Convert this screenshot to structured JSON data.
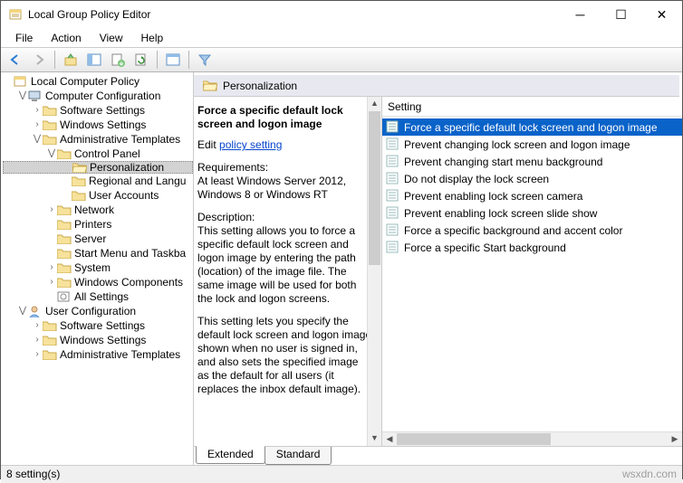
{
  "window": {
    "title": "Local Group Policy Editor"
  },
  "menu": {
    "file": "File",
    "action": "Action",
    "view": "View",
    "help": "Help"
  },
  "tree": {
    "root": "Local Computer Policy",
    "cc": "Computer Configuration",
    "ss": "Software Settings",
    "ws": "Windows Settings",
    "at": "Administrative Templates",
    "cp": "Control Panel",
    "pers": "Personalization",
    "rl": "Regional and Langu",
    "ua": "User Accounts",
    "net": "Network",
    "prn": "Printers",
    "srv": "Server",
    "smt": "Start Menu and Taskba",
    "sys": "System",
    "wc": "Windows Components",
    "allset": "All Settings",
    "uc": "User Configuration",
    "uss": "Software Settings",
    "uws": "Windows Settings",
    "uat": "Administrative Templates"
  },
  "crumb": {
    "title": "Personalization"
  },
  "desc": {
    "title": "Force a specific default lock screen and logon image",
    "edit_prefix": "Edit ",
    "edit_link": "policy setting ",
    "req_h": "Requirements:",
    "req_b": "At least Windows Server 2012, Windows 8 or Windows RT",
    "desc_h": "Description:",
    "desc_b1": "This setting allows you to force a specific default lock screen and logon image by entering the path (location) of the image file. The same image will be used for both the lock and logon screens.",
    "desc_b2": "This setting lets you specify the default lock screen and logon image shown when no user is signed in, and also sets the specified image as the default for all users (it replaces the inbox default image)."
  },
  "list": {
    "header": "Setting",
    "items": [
      "Force a specific default lock screen and logon image",
      "Prevent changing lock screen and logon image",
      "Prevent changing start menu background",
      "Do not display the lock screen",
      "Prevent enabling lock screen camera",
      "Prevent enabling lock screen slide show",
      "Force a specific background and accent color",
      "Force a specific Start background"
    ]
  },
  "tabs": {
    "ext": "Extended",
    "std": "Standard"
  },
  "status": {
    "left": "8 setting(s)",
    "right": "wsxdn.com"
  }
}
